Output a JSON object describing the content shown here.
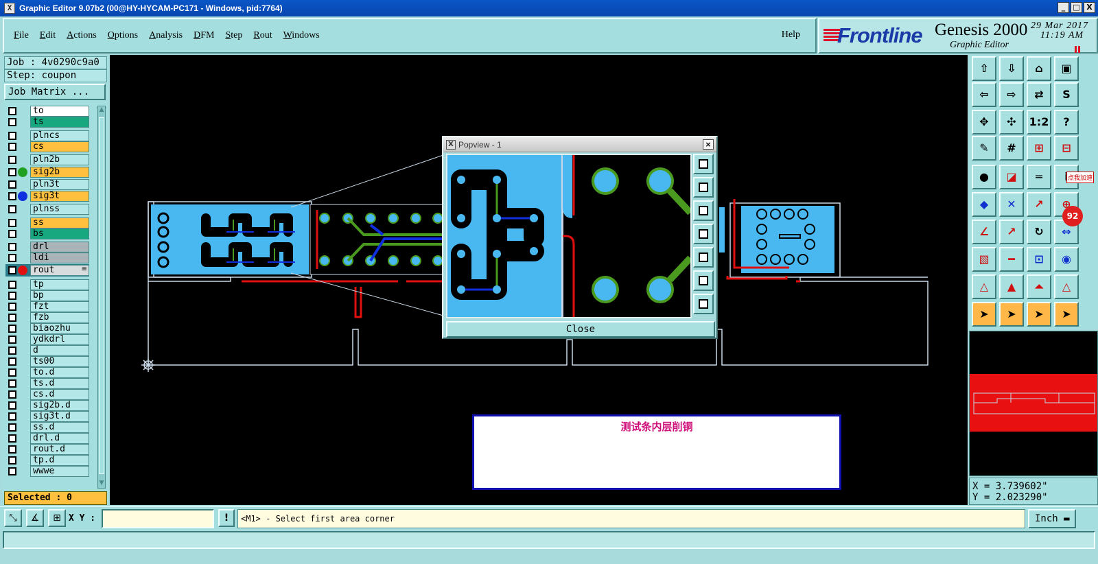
{
  "window": {
    "title": "Graphic Editor 9.07b2 (00@HY-HYCAM-PC171 - Windows, pid:7764)",
    "controls": [
      "_",
      "□",
      "X"
    ]
  },
  "menu": {
    "items": [
      "File",
      "Edit",
      "Actions",
      "Options",
      "Analysis",
      "DFM",
      "Step",
      "Rout",
      "Windows"
    ],
    "help": "Help"
  },
  "brand": {
    "logo": "Frontline",
    "product": "Genesis 2000",
    "subtitle": "Graphic Editor",
    "date": "29 Mar 2017",
    "time": "11:19 AM"
  },
  "job": {
    "job_label": "Job : 4v0290c9a0",
    "step_label": "Step: coupon",
    "job_matrix": "Job Matrix ..."
  },
  "layers": [
    {
      "name": "to",
      "style": "white"
    },
    {
      "name": "ts",
      "style": "green"
    },
    {
      "name": "plncs",
      "style": ""
    },
    {
      "name": "cs",
      "style": "orange"
    },
    {
      "name": "pln2b",
      "style": ""
    },
    {
      "name": "sig2b",
      "style": "orange",
      "dot": "#20a020"
    },
    {
      "name": "pln3t",
      "style": ""
    },
    {
      "name": "sig3t",
      "style": "orange",
      "dot": "#1030e0"
    },
    {
      "name": "plnss",
      "style": ""
    },
    {
      "name": "ss",
      "style": "orange"
    },
    {
      "name": "bs",
      "style": "green"
    },
    {
      "name": "drl",
      "style": "grey"
    },
    {
      "name": "ldi",
      "style": "grey"
    },
    {
      "name": "rout",
      "style": "light",
      "dot": "#e01010",
      "active": true
    },
    {
      "name": "tp",
      "style": ""
    },
    {
      "name": "bp",
      "style": ""
    },
    {
      "name": "fzt",
      "style": ""
    },
    {
      "name": "fzb",
      "style": ""
    },
    {
      "name": "biaozhu",
      "style": ""
    },
    {
      "name": "ydkdrl",
      "style": ""
    },
    {
      "name": "d",
      "style": ""
    },
    {
      "name": "ts00",
      "style": ""
    },
    {
      "name": "to.d",
      "style": ""
    },
    {
      "name": "ts.d",
      "style": ""
    },
    {
      "name": "cs.d",
      "style": ""
    },
    {
      "name": "sig2b.d",
      "style": ""
    },
    {
      "name": "sig3t.d",
      "style": ""
    },
    {
      "name": "ss.d",
      "style": ""
    },
    {
      "name": "drl.d",
      "style": ""
    },
    {
      "name": "rout.d",
      "style": ""
    },
    {
      "name": "tp.d",
      "style": ""
    },
    {
      "name": "wwwe",
      "style": ""
    }
  ],
  "selected": "Selected : 0",
  "popview": {
    "title": "Popview - 1",
    "close_label": "Close"
  },
  "note": {
    "text": "测试条内层削铜"
  },
  "toolbox": {
    "badge_text": "点我加速",
    "badge_number": "92"
  },
  "coords": {
    "x": "X = 3.739602\"",
    "y": "Y = 2.023290\""
  },
  "bottom": {
    "xy_label": "X Y :",
    "xy_value": "",
    "bang": "!",
    "prompt": "<M1> - Select first area corner",
    "units": "Inch"
  },
  "colors": {
    "board": "#4ab8f0",
    "copper": "#000000",
    "rout": "#e01010",
    "sig2b": "#4a9a20",
    "sig3t": "#1030e0",
    "outline": "#c8d8e8"
  }
}
